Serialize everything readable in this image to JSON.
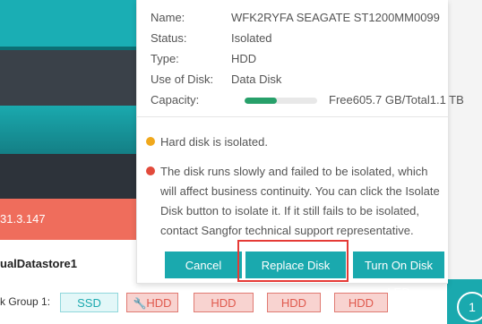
{
  "disk_info": {
    "name_label": "Name:",
    "name_value": "WFK2RYFA SEAGATE ST1200MM0099",
    "status_label": "Status:",
    "status_value": "Isolated",
    "type_label": "Type:",
    "type_value": "HDD",
    "use_label": "Use of Disk:",
    "use_value": "Data Disk",
    "capacity_label": "Capacity:",
    "capacity_value": "Free605.7 GB/Total1.1 TB",
    "capacity_used_fraction": 0.45
  },
  "notices": [
    {
      "text": "Hard disk is isolated.",
      "color": "#f0a81c"
    },
    {
      "text": "The disk runs slowly and failed to be isolated, which will affect business continuity. You can click the Isolate Disk button to isolate it. If it still fails to be isolated, contact Sangfor technical support representative.",
      "color": "#e24a3b"
    }
  ],
  "buttons": {
    "cancel": "Cancel",
    "replace_disk": "Replace Disk",
    "turn_on_led": "Turn On Disk LED"
  },
  "background": {
    "ip_fragment": "31.3.147",
    "datastore_name": "ualDatastore1",
    "disk_group_label": "k Group 1:",
    "disks": [
      "SSD",
      "HDD",
      "HDD",
      "HDD",
      "HDD"
    ],
    "badge_number": "1"
  },
  "colors": {
    "accent": "#1aa9ae",
    "error": "#e24a3b",
    "warning": "#f0a81c",
    "highlight": "#e53a36"
  },
  "icons": {
    "hdd_wrench": "wrench-icon"
  }
}
